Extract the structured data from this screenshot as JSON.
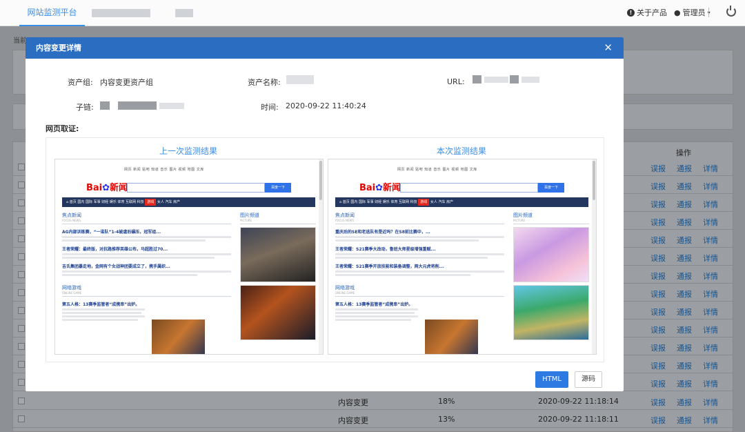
{
  "topbar": {
    "platform_tab": "网站监测平台",
    "about_label": "关于产品",
    "user_label": "管理员"
  },
  "background": {
    "breadcrumb_prefix": "当前",
    "column_action": "操作",
    "row_actions": [
      "误报",
      "通报",
      "详情"
    ],
    "visible_rows": [
      {
        "type": "内容变更",
        "rate": "18%",
        "time": "2020-09-22 11:18:14"
      },
      {
        "type": "内容变更",
        "rate": "13%",
        "time": "2020-09-22 11:18:11"
      }
    ]
  },
  "modal": {
    "title": "内容变更详情",
    "close_icon": "close-icon",
    "fields": {
      "asset_group_label": "资产组:",
      "asset_group_value": "内容变更资产组",
      "asset_name_label": "资产名称:",
      "url_label": "URL:",
      "sublink_label": "子链:",
      "time_label": "时间:",
      "time_value": "2020-09-22 11:40:24"
    },
    "evidence_label": "网页取证:",
    "prev_title": "上一次监测结果",
    "curr_title": "本次监测结果",
    "html_button": "HTML",
    "source_button": "源码"
  },
  "snapshot": {
    "topnav": "网页 新闻 贴吧 知道 音乐 图片 视频 地图 文库",
    "logo_text": "Bai",
    "logo_suffix": "新闻",
    "search_button": "百度一下",
    "nav_items": [
      "首页",
      "国内",
      "国际",
      "军事",
      "财经",
      "娱乐",
      "体育",
      "互联网",
      "科技",
      "游戏",
      "女人",
      "汽车",
      "房产"
    ],
    "nav_active": "游戏",
    "focus_section": "焦点新闻",
    "focus_sub": "FOCUS NEWS",
    "image_section": "图片频道",
    "image_sub": "PICTURE",
    "game_section": "网络游戏",
    "game_sub": "ONLINE GAME",
    "prev_headlines": [
      "AG内部训练赛，“一诺队”1-4被虐后碾压，冠军组...",
      "王者荣耀：最终版，对抗路推荐英雄公布，马超胜过70...",
      "吉氏集团暴走地，金网有个女战神团要成立了，携手属织..."
    ],
    "curr_headlines": [
      "重庆后的SE和老选队有是近吗？在S8前比赛中，...",
      "王者荣耀：S21赛季大改动，鲁班大师星级增强重赋...",
      "王者荣耀：S21赛季开放技能和装备调整，两大元虎将削..."
    ],
    "game_headline": "第五人格：13赛季监管者“成携串”出炉。"
  }
}
